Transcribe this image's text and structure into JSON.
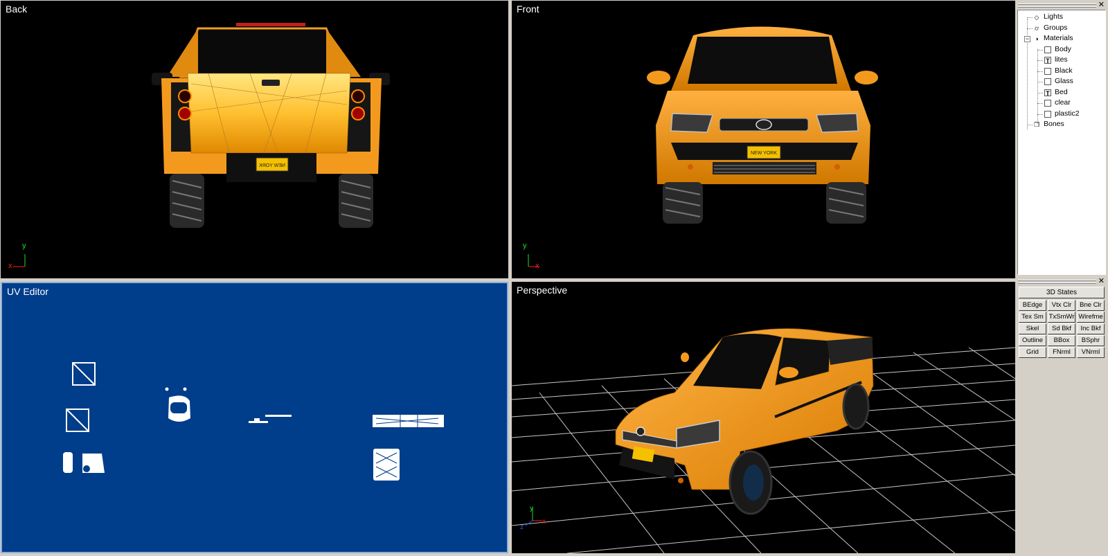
{
  "viewports": {
    "back": {
      "label": "Back"
    },
    "front": {
      "label": "Front"
    },
    "uv": {
      "label": "UV Editor"
    },
    "perspective": {
      "label": "Perspective"
    }
  },
  "axes": {
    "x": "x",
    "y": "y",
    "z": "z"
  },
  "plate_text": "NEW YORK",
  "scene_tree": {
    "items": [
      {
        "label": "Lights",
        "icon": "diamond-icon"
      },
      {
        "label": "Groups",
        "icon": "cylinder-icon"
      },
      {
        "label": "Materials",
        "icon": "sphere-icon",
        "expanded": true,
        "children": [
          {
            "label": "Body",
            "icon": "material-box-icon"
          },
          {
            "label": "lites",
            "icon": "texture-box-icon"
          },
          {
            "label": "Black",
            "icon": "material-box-icon"
          },
          {
            "label": "Glass",
            "icon": "material-box-icon"
          },
          {
            "label": "Bed",
            "icon": "texture-box-icon"
          },
          {
            "label": "clear",
            "icon": "material-box-icon"
          },
          {
            "label": "plastic2",
            "icon": "material-box-icon"
          }
        ]
      },
      {
        "label": "Bones",
        "icon": "bones-icon"
      }
    ]
  },
  "render_panel": {
    "title_button": "3D States",
    "buttons": [
      "BEdge",
      "Vtx Clr",
      "Bne Clr",
      "Tex Sm",
      "TxSmWr",
      "Wirefme",
      "Skel",
      "Sd Bkf",
      "Inc Bkf",
      "Outline",
      "BBox",
      "BSphr",
      "Grid",
      "FNrml",
      "VNrml"
    ]
  },
  "colors": {
    "viewport_bg": "#000000",
    "uv_bg": "#003d8a",
    "body": "#f39a1e",
    "panel_bg": "#d4d0c8",
    "axis_x": "#ff2020",
    "axis_y": "#20e020",
    "axis_z": "#3050ff"
  }
}
